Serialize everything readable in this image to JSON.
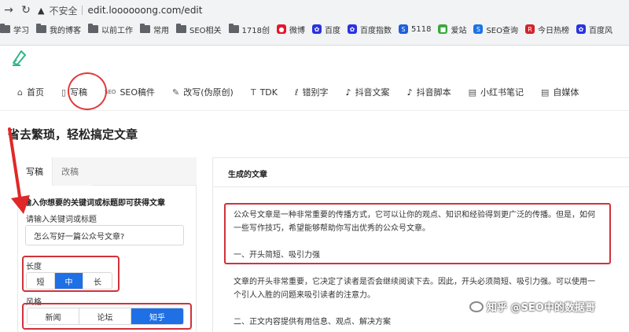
{
  "browser": {
    "insecure_label": "不安全",
    "url": "edit.loooooong.com/edit",
    "bookmarks": [
      {
        "label": "学习",
        "icon": "folder-icon"
      },
      {
        "label": "我的博客",
        "icon": "folder-icon"
      },
      {
        "label": "以前工作",
        "icon": "folder-icon"
      },
      {
        "label": "常用",
        "icon": "folder-icon"
      },
      {
        "label": "SEO相关",
        "icon": "folder-icon"
      },
      {
        "label": "1718创",
        "icon": "folder-icon"
      },
      {
        "label": "微博",
        "icon": "weibo-icon"
      },
      {
        "label": "百度",
        "icon": "baidu-icon"
      },
      {
        "label": "百度指数",
        "icon": "baidu-icon"
      },
      {
        "label": "5118",
        "icon": "5118-icon"
      },
      {
        "label": "爱站",
        "icon": "aizhan-icon"
      },
      {
        "label": "SEO查询",
        "icon": "seo-icon"
      },
      {
        "label": "今日热榜",
        "icon": "r-icon"
      },
      {
        "label": "百度风",
        "icon": "baidu-icon"
      }
    ]
  },
  "nav": {
    "items": [
      {
        "label": "首页",
        "icon": "home-icon"
      },
      {
        "label": "写稿",
        "icon": "document-icon"
      },
      {
        "label": "SEO稿件",
        "icon": "seo-icon"
      },
      {
        "label": "改写(伪原创)",
        "icon": "rewrite-icon"
      },
      {
        "label": "TDK",
        "icon": "t-icon"
      },
      {
        "label": "错别字",
        "icon": "spell-icon"
      },
      {
        "label": "抖音文案",
        "icon": "tiktok-icon"
      },
      {
        "label": "抖音脚本",
        "icon": "tiktok-icon"
      },
      {
        "label": "小红书笔记",
        "icon": "note-icon"
      },
      {
        "label": "自媒体",
        "icon": "note-icon"
      }
    ]
  },
  "page_title": "省去繁琐，轻松搞定文章",
  "left": {
    "tabs": [
      {
        "label": "写稿",
        "active": true
      },
      {
        "label": "改稿",
        "active": false
      }
    ],
    "hint": "输入你想要的关键词或标题即可获得文章",
    "keyword_label": "请输入关键词或标题",
    "keyword_value": "怎么写好一篇公众号文章?",
    "length_label": "长度",
    "length_options": [
      "短",
      "中",
      "长"
    ],
    "length_selected": "中",
    "style_label": "风格",
    "style_options": [
      "新闻",
      "论坛",
      "知乎"
    ],
    "style_selected": "知乎"
  },
  "right": {
    "title": "生成的文章",
    "lines": [
      "公众号文章是一种非常重要的传播方式，它可以让你的观点、知识和经验得到更广泛的传播。但是，如何",
      "一些写作技巧，希望能够帮助你写出优秀的公众号文章。",
      "",
      "一、开头简短、吸引力强",
      "",
      "文章的开头非常重要，它决定了读者是否会继续阅读下去。因此，开头必须简短、吸引力强。可以使用一",
      "个引人入胜的问题来吸引读者的注意力。",
      "",
      "二、正文内容提供有用信息、观点、解决方案"
    ]
  },
  "watermark": "知乎 @SEO中的数据哥"
}
